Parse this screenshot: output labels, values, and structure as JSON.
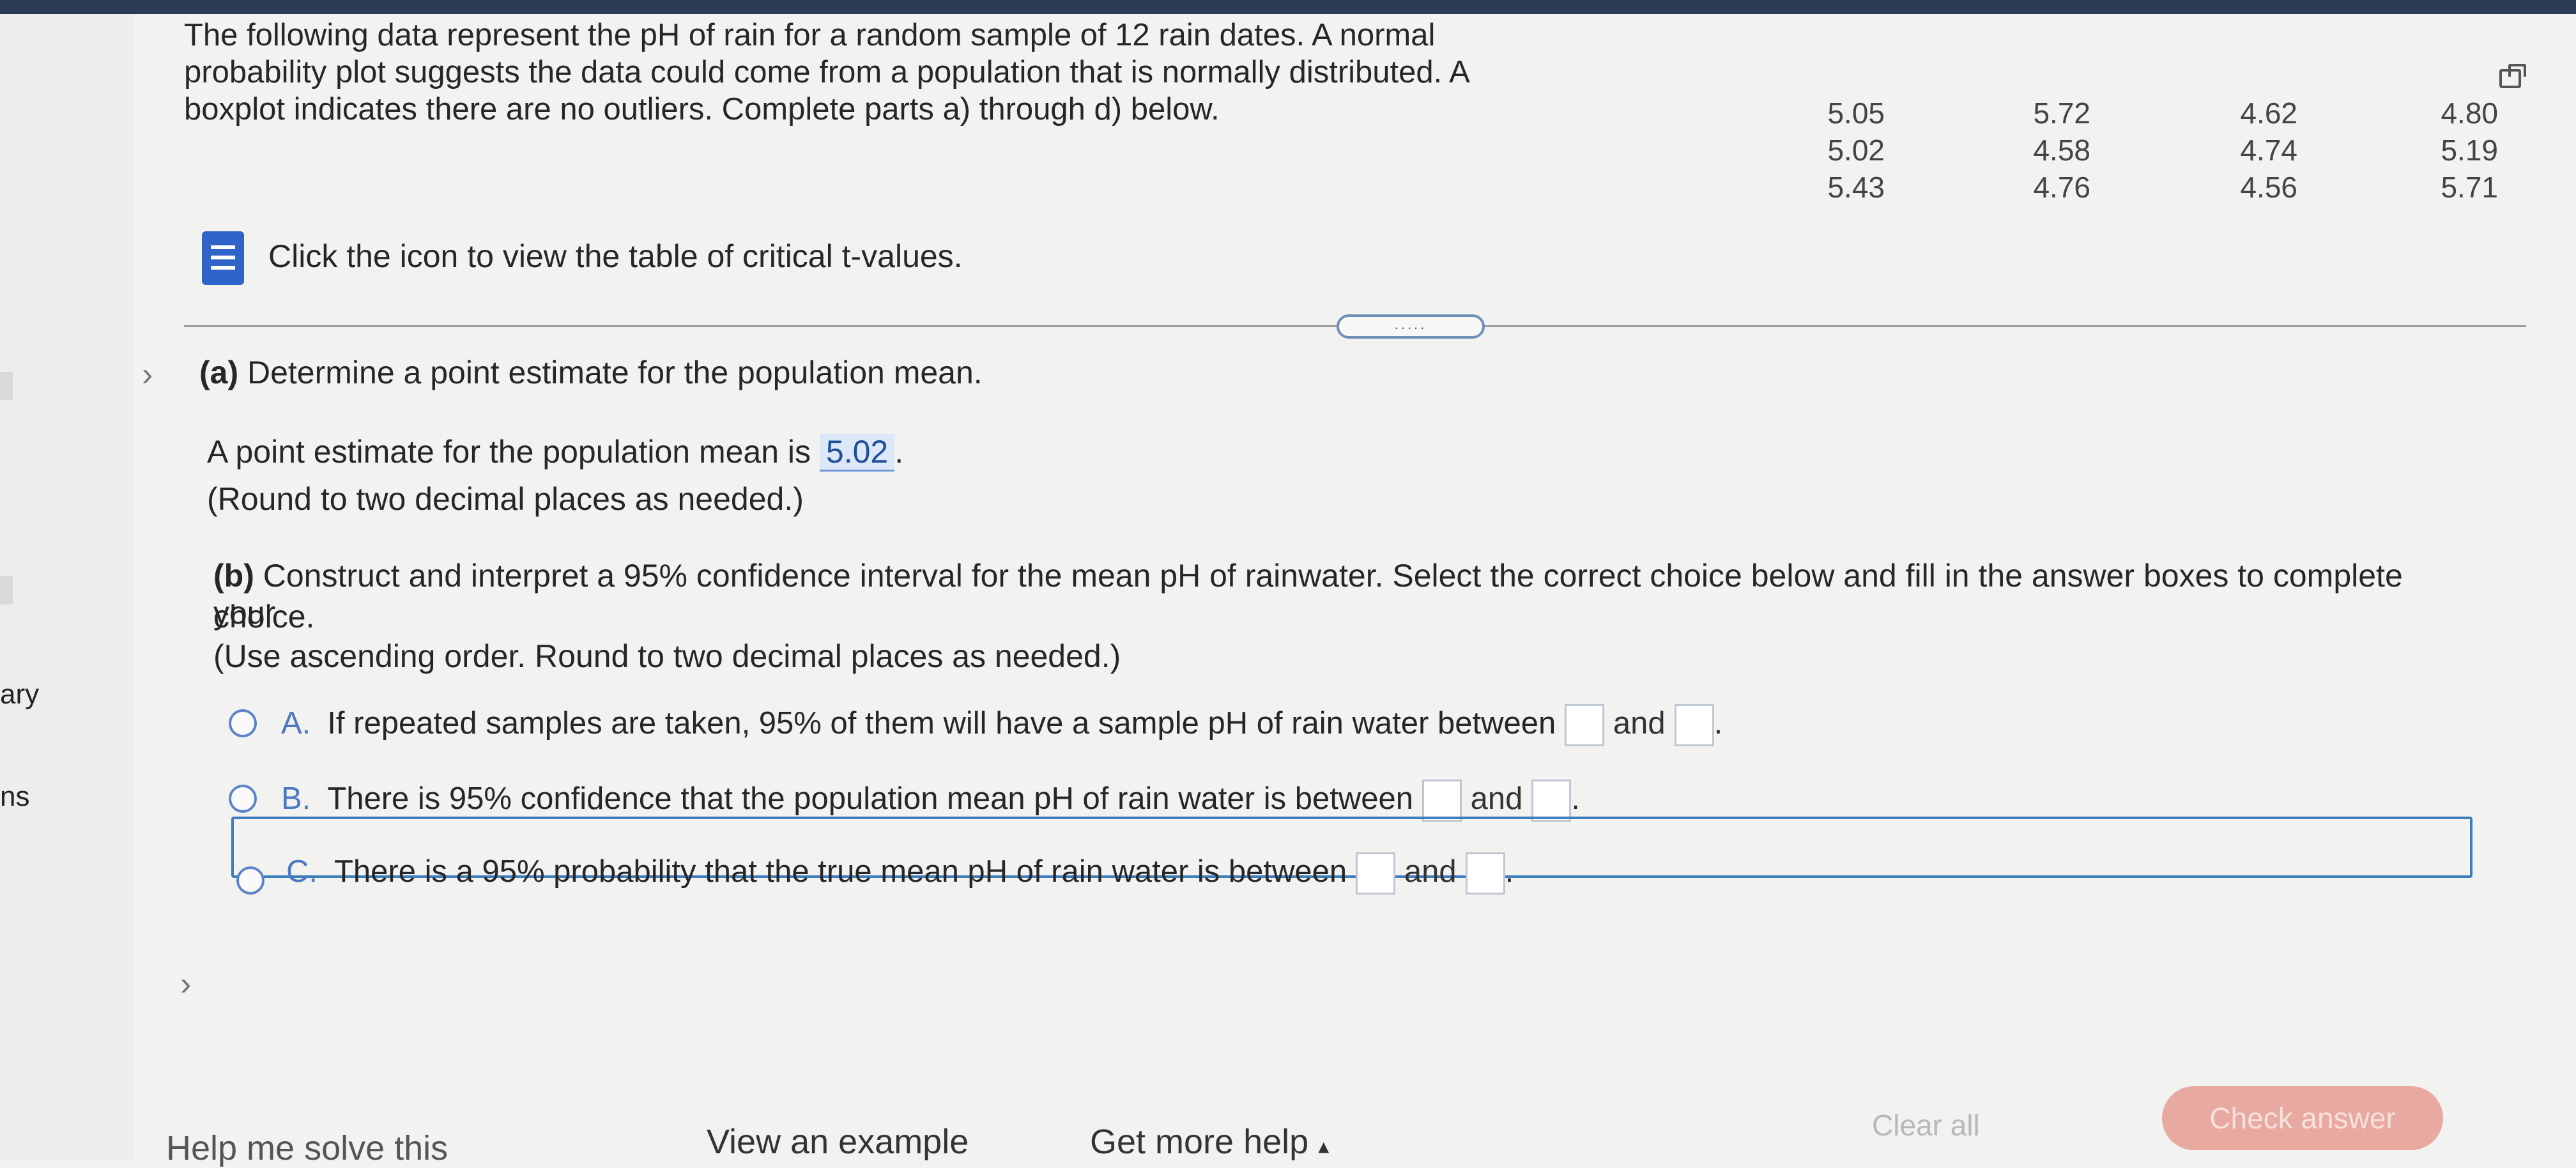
{
  "sidebar": {
    "labels": [
      "ary",
      "ns"
    ]
  },
  "problem": {
    "lines": [
      "The following data represent the pH of rain for a random sample of 12 rain dates. A normal",
      "probability plot suggests the data could come from a population that is normally distributed. A",
      "boxplot indicates there are no outliers. Complete parts a) through d) below."
    ]
  },
  "data_table": {
    "columns": [
      [
        "5.05",
        "5.02",
        "5.43"
      ],
      [
        "5.72",
        "4.58",
        "4.76"
      ],
      [
        "4.62",
        "4.74",
        "4.56"
      ],
      [
        "4.80",
        "5.19",
        "5.71"
      ]
    ]
  },
  "table_link": {
    "label": "Click the icon to view the table of critical t-values."
  },
  "handle_label": ".....",
  "part_a": {
    "heading_bold": "(a)",
    "heading": " Determine a point estimate for the population mean.",
    "answer_prefix": "A point estimate for the population mean is ",
    "answer_value": "5.02",
    "answer_suffix": ".",
    "note": "(Round to two decimal places as needed.)"
  },
  "part_b": {
    "heading_bold": "(b)",
    "heading_line1": " Construct and interpret a 95% confidence interval for the mean pH of rainwater. Select the correct choice below and fill in the answer boxes to complete your",
    "heading_line2": "choice.",
    "note": "(Use ascending order. Round to two decimal places as needed.)",
    "options": [
      {
        "letter": "A.",
        "text": "If repeated samples are taken, 95% of them will have a sample pH of rain water between",
        "and": "and",
        "end": "."
      },
      {
        "letter": "B.",
        "text": "There is 95% confidence that the population mean pH of rain water is between",
        "and": "and",
        "end": "."
      },
      {
        "letter": "C.",
        "text": "There is a 95% probability that the true mean pH of rain water is between",
        "and": "and",
        "end": "."
      }
    ]
  },
  "footer": {
    "help_solve": "Help me solve this",
    "view_example": "View an example",
    "get_more_help": "Get more help",
    "clear_all": "Clear all",
    "check_answer": "Check answer"
  },
  "colors": {
    "accent": "#2e64c8",
    "selected_border": "#3d7fbd",
    "check_button": "#e8a9a0"
  }
}
